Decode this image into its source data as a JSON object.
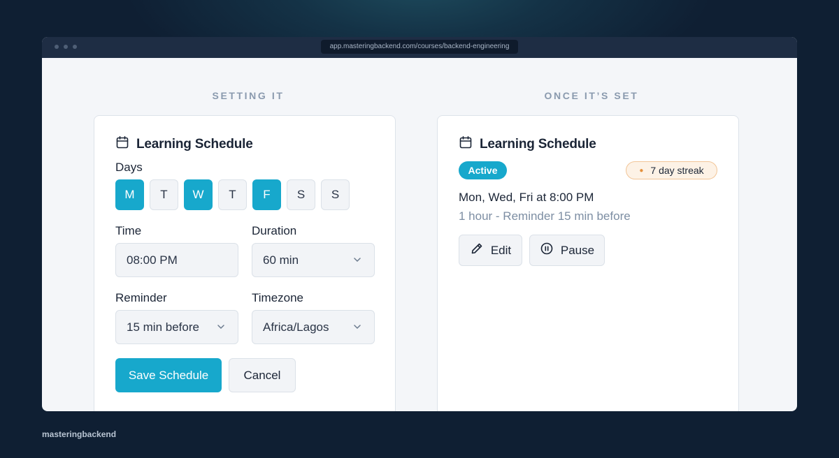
{
  "browser": {
    "url": "app.masteringbackend.com/courses/backend-engineering"
  },
  "left": {
    "section_title": "SETTING IT",
    "card_title": "Learning Schedule",
    "days_label": "Days",
    "days": [
      {
        "label": "M",
        "selected": true
      },
      {
        "label": "T",
        "selected": false
      },
      {
        "label": "W",
        "selected": true
      },
      {
        "label": "T",
        "selected": false
      },
      {
        "label": "F",
        "selected": true
      },
      {
        "label": "S",
        "selected": false
      },
      {
        "label": "S",
        "selected": false
      }
    ],
    "time_label": "Time",
    "time_value": "08:00 PM",
    "duration_label": "Duration",
    "duration_value": "60 min",
    "reminder_label": "Reminder",
    "reminder_value": "15 min before",
    "timezone_label": "Timezone",
    "timezone_value": "Africa/Lagos",
    "save_label": "Save Schedule",
    "cancel_label": "Cancel"
  },
  "right": {
    "section_title": "ONCE IT’S SET",
    "card_title": "Learning Schedule",
    "status_badge": "Active",
    "streak_badge": "7 day streak",
    "schedule_summary": "Mon, Wed, Fri at 8:00 PM",
    "schedule_detail": "1 hour - Reminder 15 min before",
    "edit_label": "Edit",
    "pause_label": "Pause"
  },
  "footer": {
    "brand": "masteringbackend"
  },
  "colors": {
    "accent": "#17a8cc",
    "background": "#0f1f33",
    "streak_bg": "#fdf2e6",
    "streak_border": "#f2c597"
  },
  "icons": {
    "calendar": "calendar-icon",
    "chevron": "chevron-down-icon",
    "pencil": "pencil-icon",
    "pause": "pause-circle-icon",
    "flame": "flame-icon"
  }
}
